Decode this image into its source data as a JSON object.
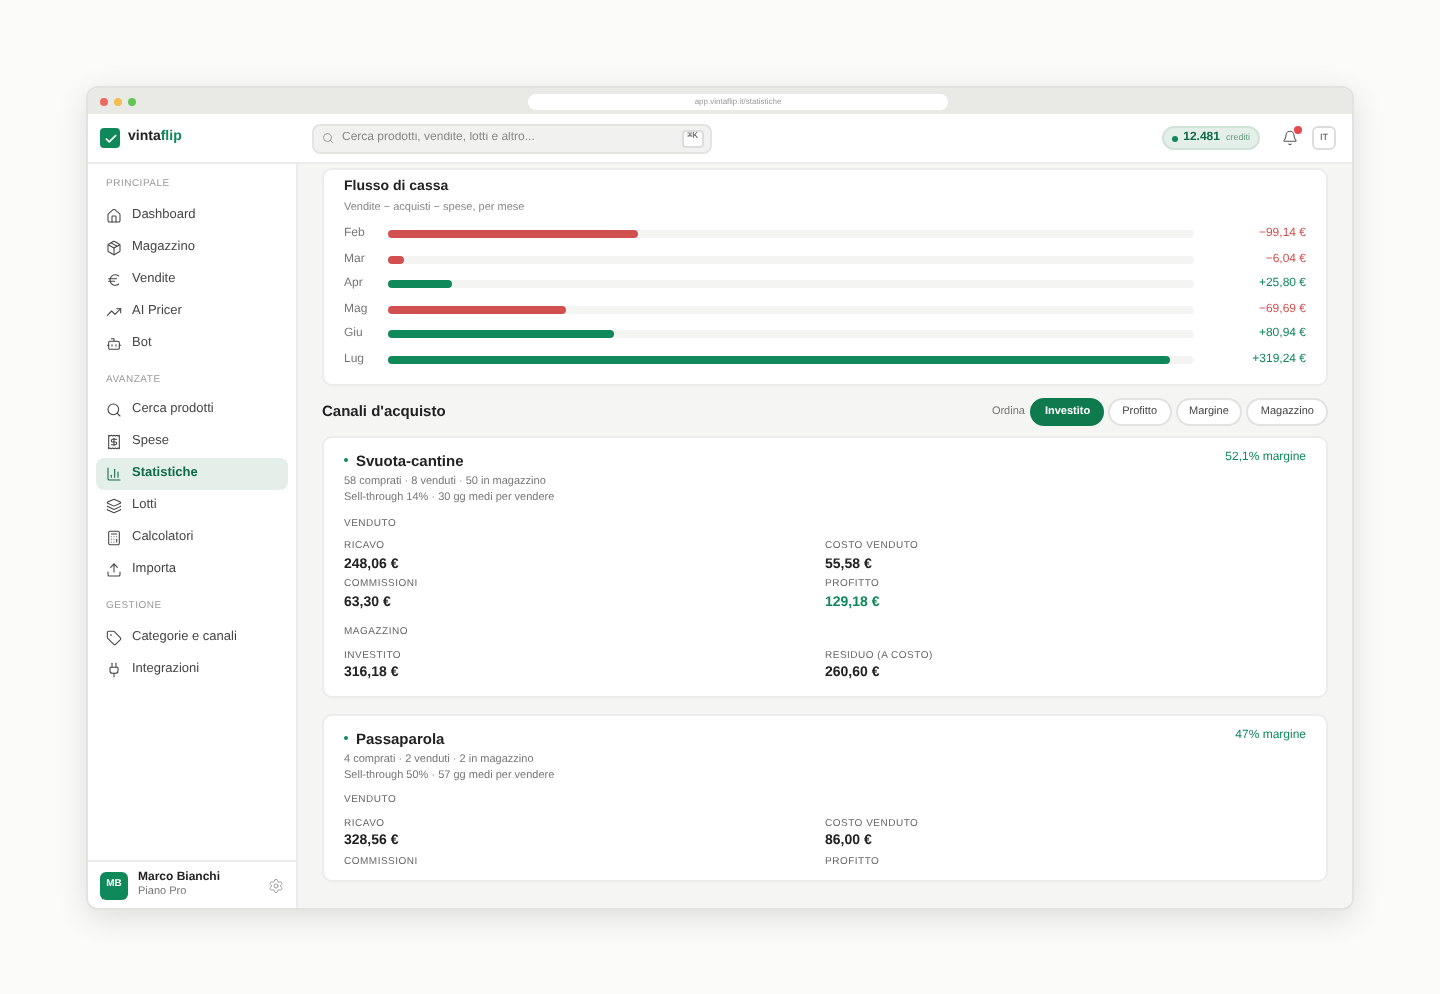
{
  "browser": {
    "url": "app.vintaflip.it/statistiche"
  },
  "header": {
    "logo_text": "vinta",
    "logo_accent": "flip",
    "search": {
      "placeholder": "Cerca prodotti, vendite, lotti e altro...",
      "shortcut": "⌘K"
    },
    "credits": {
      "value": "12.481",
      "unit": "crediti"
    },
    "notifications": {
      "unread": true
    },
    "language": "IT"
  },
  "sidebar": {
    "sections": [
      {
        "title": "PRINCIPALE",
        "items": [
          {
            "label": "Dashboard",
            "selected": false
          },
          {
            "label": "Magazzino",
            "selected": false
          },
          {
            "label": "Vendite",
            "selected": false
          },
          {
            "label": "AI Pricer",
            "selected": false
          },
          {
            "label": "Bot",
            "selected": false
          }
        ]
      },
      {
        "title": "AVANZATE",
        "items": [
          {
            "label": "Cerca prodotti",
            "selected": false
          },
          {
            "label": "Spese",
            "selected": false
          },
          {
            "label": "Statistiche",
            "selected": true
          },
          {
            "label": "Lotti",
            "selected": false
          },
          {
            "label": "Calcolatori",
            "selected": false
          },
          {
            "label": "Importa",
            "selected": false
          }
        ]
      },
      {
        "title": "GESTIONE",
        "items": [
          {
            "label": "Categorie e canali",
            "selected": false
          },
          {
            "label": "Integrazioni",
            "selected": false
          }
        ]
      }
    ],
    "user": {
      "initials": "MB",
      "name": "Marco Bianchi",
      "plan": "Piano Pro"
    }
  },
  "cash_flow": {
    "title": "Flusso di cassa",
    "subtitle": "Vendite − acquisti − spese, per mese",
    "rows": [
      {
        "month": "Feb",
        "color": "#d1504f",
        "level": 0.31,
        "value": "−99,14 €"
      },
      {
        "month": "Mar",
        "color": "#d1504f",
        "level": 0.02,
        "value": "−6,04 €"
      },
      {
        "month": "Apr",
        "color": "#10895a",
        "level": 0.08,
        "value": "+25,80 €"
      },
      {
        "month": "Mag",
        "color": "#d1504f",
        "level": 0.22,
        "value": "−69,69 €"
      },
      {
        "month": "Giu",
        "color": "#10895a",
        "level": 0.28,
        "value": "+80,94 €"
      },
      {
        "month": "Lug",
        "color": "#10895a",
        "level": 0.97,
        "value": "+319,24 €"
      }
    ]
  },
  "channels": {
    "title": "Canali d'acquisto",
    "sort_label": "Ordina",
    "sort_options": [
      {
        "label": "Investito",
        "selected": true
      },
      {
        "label": "Profitto",
        "selected": false
      },
      {
        "label": "Margine",
        "selected": false
      },
      {
        "label": "Magazzino",
        "selected": false
      }
    ],
    "cards": [
      {
        "name": "Svuota-cantine",
        "stats": "58 comprati · 8 venduti · 50 in magazzino",
        "sell_through": "Sell-through 14% · 30 gg medi per vendere",
        "margin": "52,1% margine",
        "groups": [
          {
            "title": "VENDUTO",
            "metrics": [
              {
                "label": "RICAVO",
                "value": "248,06 €",
                "color": "#222222"
              },
              {
                "label": "COSTO VENDUTO",
                "value": "55,58 €",
                "color": "#222222"
              },
              {
                "label": "COMMISSIONI",
                "value": "63,30 €",
                "color": "#222222"
              },
              {
                "label": "PROFITTO",
                "value": "129,18 €",
                "color": "#10895a"
              }
            ]
          },
          {
            "title": "MAGAZZINO",
            "metrics": [
              {
                "label": "INVESTITO",
                "value": "316,18 €",
                "color": "#222222"
              },
              {
                "label": "RESIDUO (A COSTO)",
                "value": "260,60 €",
                "color": "#222222"
              }
            ]
          }
        ]
      },
      {
        "name": "Passaparola",
        "stats": "4 comprati · 2 venduti · 2 in magazzino",
        "sell_through": "Sell-through 50% · 57 gg medi per vendere",
        "margin": "47% margine",
        "groups": [
          {
            "title": "VENDUTO",
            "metrics": [
              {
                "label": "RICAVO",
                "value": "328,56 €",
                "color": "#222222"
              },
              {
                "label": "COSTO VENDUTO",
                "value": "86,00 €",
                "color": "#222222"
              },
              {
                "label": "COMMISSIONI"
              },
              {
                "label": "PROFITTO"
              }
            ]
          }
        ]
      }
    ]
  }
}
